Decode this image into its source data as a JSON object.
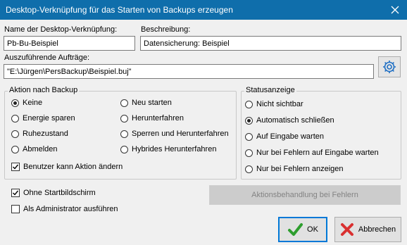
{
  "window": {
    "title": "Desktop-Verknüpfung für das Starten von Backups erzeugen"
  },
  "colors": {
    "titlebar": "#0f6eab",
    "accent": "#0078d7"
  },
  "form": {
    "shortcut_name_label": "Name der Desktop-Verknüpfung:",
    "shortcut_name_value": "Pb-Bu-Beispiel",
    "description_label": "Beschreibung:",
    "description_value": "Datensicherung: Beispiel",
    "jobs_label": "Auszuführende Aufträge:",
    "jobs_value": "\"E:\\Jürgen\\PersBackup\\Beispiel.buj\""
  },
  "action_group": {
    "legend": "Aktion nach Backup",
    "options": [
      "Keine",
      "Energie sparen",
      "Ruhezustand",
      "Abmelden",
      "Neu starten",
      "Herunterfahren",
      "Sperren und Herunterfahren",
      "Hybrides Herunterfahren"
    ],
    "selected": "Keine",
    "user_can_change_label": "Benutzer kann Aktion ändern",
    "user_can_change_checked": true
  },
  "status_group": {
    "legend": "Statusanzeige",
    "options": [
      "Nicht sichtbar",
      "Automatisch schließen",
      "Auf Eingabe warten",
      "Nur bei Fehlern auf Eingabe warten",
      "Nur bei Fehlern anzeigen"
    ],
    "selected": "Automatisch schließen"
  },
  "options": {
    "no_splash_label": "Ohne Startbildschirm",
    "no_splash_checked": true,
    "run_as_admin_label": "Als Administrator ausführen",
    "run_as_admin_checked": false
  },
  "buttons": {
    "error_handling": "Aktionsbehandlung bei Fehlern",
    "ok": "OK",
    "cancel": "Abbrechen"
  },
  "icons": {
    "close": "close-icon",
    "gear": "gear-icon",
    "ok": "checkmark-icon",
    "cancel": "cross-icon"
  }
}
